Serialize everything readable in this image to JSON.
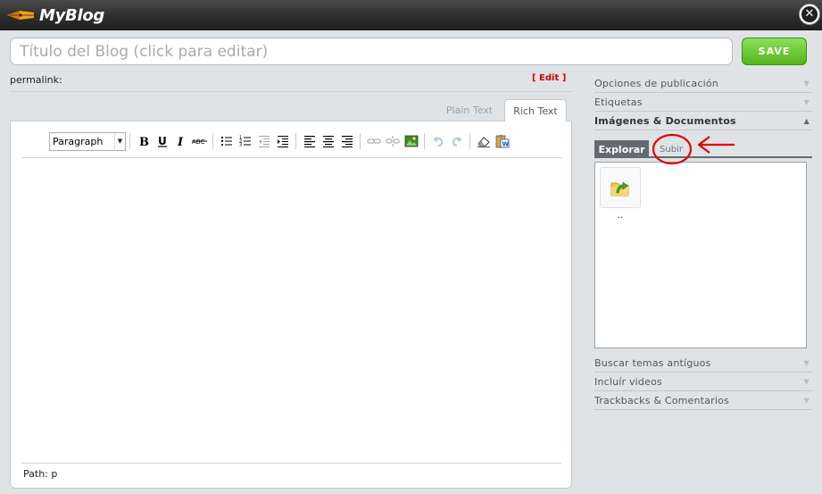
{
  "app": {
    "title": "MyBlog"
  },
  "header": {
    "title_placeholder": "Título del Blog (click para editar)",
    "save_label": "SAVE"
  },
  "permalink": {
    "label": "permalink:",
    "edit_label": "[ Edit ]"
  },
  "editor": {
    "tabs": [
      {
        "label": "Plain Text"
      },
      {
        "label": "Rich Text"
      }
    ],
    "active_tab": "Rich Text",
    "format_select": "Paragraph",
    "path_label": "Path: p"
  },
  "panel": {
    "sections": [
      {
        "label": "Opciones de publicación"
      },
      {
        "label": "Etiquetas"
      },
      {
        "label": "Imágenes & Documentos"
      },
      {
        "label": "Buscar temas antíguos"
      },
      {
        "label": "Incluír videos"
      },
      {
        "label": "Trackbacks & Comentarios"
      }
    ],
    "active_section": "Imágenes & Documentos",
    "subtabs": [
      {
        "label": "Explorar"
      },
      {
        "label": "Subir"
      }
    ],
    "active_subtab": "Explorar",
    "files": [
      {
        "name": ".."
      }
    ]
  },
  "colors": {
    "titlebar": "#2c2c2c",
    "save_green": "#52b41b",
    "edit_red": "#d40000",
    "annotation_red": "#e00000",
    "subtab_active": "#636b70"
  }
}
